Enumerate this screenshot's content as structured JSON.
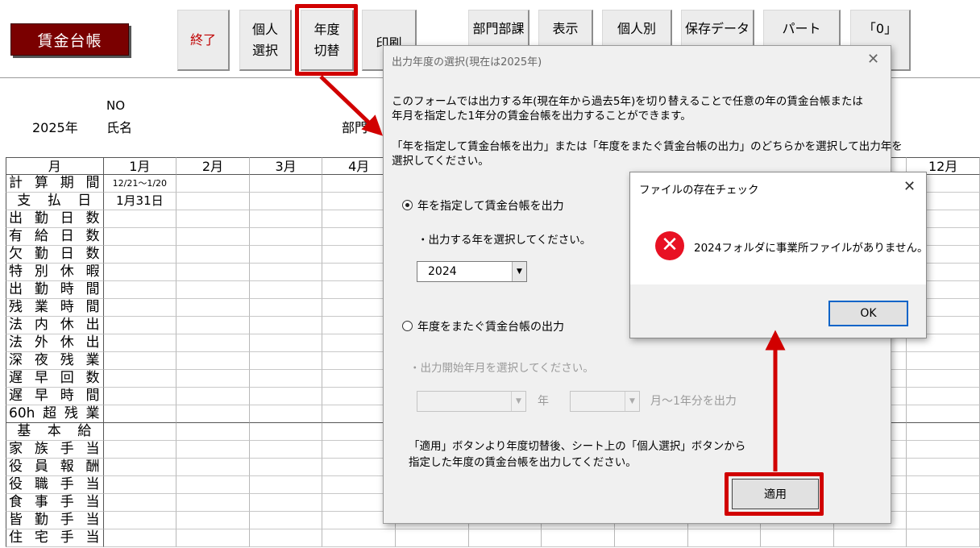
{
  "sheet": {
    "title": "賃金台帳",
    "toolbar": {
      "end": "終了",
      "personal_select": [
        "個人",
        "選択"
      ],
      "year_switch": [
        "年度",
        "切替"
      ],
      "print": "印刷",
      "dept": "部門部課",
      "display": "表示",
      "by_person": "個人別",
      "saved_data": "保存データ",
      "part": "パート",
      "zero": "「0」"
    },
    "year": "2025年",
    "no_label": "NO",
    "name_label": "氏名",
    "dept_label": "部門",
    "months_header": [
      "月",
      "1月",
      "2月",
      "3月",
      "4月",
      "12月"
    ],
    "rows": [
      {
        "label": [
          "計",
          "算",
          "期",
          "間"
        ],
        "m1": "12/21〜1/20"
      },
      {
        "label": [
          "支",
          "払",
          "日"
        ],
        "m1": "1月31日"
      },
      {
        "label": [
          "出",
          "勤",
          "日",
          "数"
        ]
      },
      {
        "label": [
          "有",
          "給",
          "日",
          "数"
        ]
      },
      {
        "label": [
          "欠",
          "勤",
          "日",
          "数"
        ]
      },
      {
        "label": [
          "特",
          "別",
          "休",
          "暇"
        ]
      },
      {
        "label": [
          "出",
          "勤",
          "時",
          "間"
        ]
      },
      {
        "label": [
          "残",
          "業",
          "時",
          "間"
        ]
      },
      {
        "label": [
          "法",
          "内",
          "休",
          "出"
        ]
      },
      {
        "label": [
          "法",
          "外",
          "休",
          "出"
        ]
      },
      {
        "label": [
          "深",
          "夜",
          "残",
          "業"
        ]
      },
      {
        "label": [
          "遅",
          "早",
          "回",
          "数"
        ]
      },
      {
        "label": [
          "遅",
          "早",
          "時",
          "間"
        ]
      },
      {
        "label": [
          "60h",
          "超",
          "残",
          "業"
        ]
      },
      {
        "label": [
          "基",
          "本",
          "給"
        ]
      },
      {
        "label": [
          "家",
          "族",
          "手",
          "当"
        ]
      },
      {
        "label": [
          "役",
          "員",
          "報",
          "酬"
        ]
      },
      {
        "label": [
          "役",
          "職",
          "手",
          "当"
        ]
      },
      {
        "label": [
          "食",
          "事",
          "手",
          "当"
        ]
      },
      {
        "label": [
          "皆",
          "勤",
          "手",
          "当"
        ]
      },
      {
        "label": [
          "住",
          "宅",
          "手",
          "当"
        ]
      }
    ]
  },
  "year_dialog": {
    "title": "出力年度の選択(現在は2025年)",
    "desc1": "このフォームでは出力する年(現在年から過去5年)を切り替えることで任意の年の賃金台帳または",
    "desc2": "年月を指定した1年分の賃金台帳を出力することができます。",
    "desc3": "「年を指定して賃金台帳を出力」または「年度をまたぐ賃金台帳の出力」のどちらかを選択して出力年を",
    "desc4": "選択してください。",
    "option1": "年を指定して賃金台帳を出力",
    "option1_hint": "・出力する年を選択してください。",
    "year_value": "2024",
    "option2": "年度をまたぐ賃金台帳の出力",
    "option2_hint": "・出力開始年月を選択してください。",
    "year_suffix": "年",
    "month_suffix": "月～1年分を出力",
    "note1": "「適用」ボタンより年度切替後、シート上の「個人選択」ボタンから",
    "note2": "指定した年度の賃金台帳を出力してください。",
    "apply": "適用"
  },
  "file_dialog": {
    "title": "ファイルの存在チェック",
    "message": "2024フォルダに事業所ファイルがありません。",
    "ok": "OK"
  },
  "colors": {
    "accent_red": "#d10000",
    "title_bg": "#7a0000",
    "error_icon": "#e81123"
  }
}
